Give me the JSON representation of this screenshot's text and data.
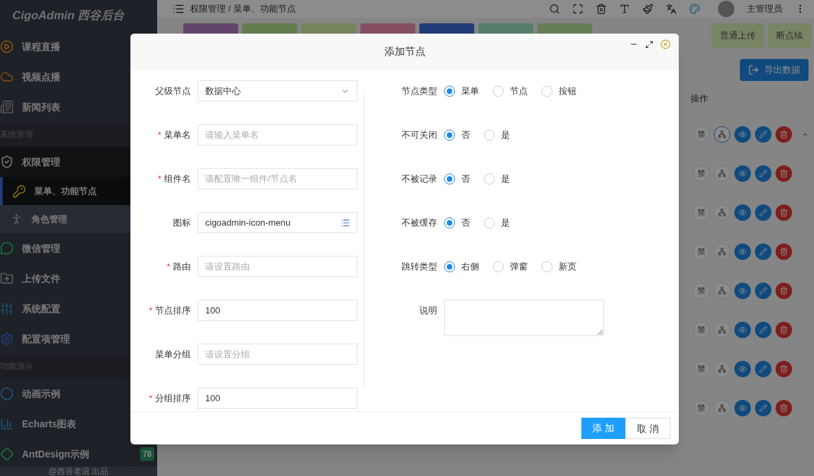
{
  "sidebar": {
    "logo": "CigoAdmin 西谷后台",
    "items": [
      {
        "kind": "item",
        "label": "课程直播",
        "selected": false
      },
      {
        "kind": "item",
        "label": "视频点播",
        "selected": false
      },
      {
        "kind": "item",
        "label": "新闻列表",
        "selected": false
      },
      {
        "kind": "group",
        "label": "系统管理"
      },
      {
        "kind": "item",
        "label": "权限管理",
        "selected": false,
        "expanded": true,
        "children": [
          {
            "label": "菜单、功能节点",
            "selected": true
          },
          {
            "label": "角色管理",
            "selected": false
          }
        ]
      },
      {
        "kind": "item",
        "label": "微信管理",
        "selected": false
      },
      {
        "kind": "item",
        "label": "上传文件",
        "selected": false
      },
      {
        "kind": "item",
        "label": "系统配置",
        "selected": false
      },
      {
        "kind": "item",
        "label": "配置项管理",
        "selected": false
      },
      {
        "kind": "group",
        "label": "功能演示"
      },
      {
        "kind": "item",
        "label": "动画示例",
        "selected": false
      },
      {
        "kind": "item",
        "label": "Echarts图表",
        "selected": false
      },
      {
        "kind": "item",
        "label": "AntDesign示例",
        "badge": "78",
        "selected": false
      }
    ],
    "footer": "@西谷老温 出品"
  },
  "topbar": {
    "breadcrumb": "权限管理 / 菜单、功能节点",
    "user": "主管理员"
  },
  "upload_tabs": [
    "普通上传",
    "断点续"
  ],
  "export_button": "导出数据",
  "table": {
    "action_header": "操作",
    "rows": [
      {
        "ban": "禁",
        "focused": true
      },
      {
        "ban": "禁",
        "focused": false
      },
      {
        "ban": "禁",
        "focused": false
      },
      {
        "ban": "禁",
        "focused": false
      },
      {
        "ban": "禁",
        "focused": false
      },
      {
        "ban": "禁",
        "focused": false
      },
      {
        "ban": "禁",
        "focused": false
      },
      {
        "ban": "禁",
        "focused": false
      }
    ]
  },
  "dialog": {
    "title": "添加节点",
    "left_fields": [
      {
        "kind": "select",
        "label": "父级节点",
        "value": "数据中心"
      },
      {
        "kind": "input",
        "label": "菜单名",
        "mark": "*",
        "placeholder": "请输入菜单名"
      },
      {
        "kind": "input",
        "label": "组件名",
        "mark": "*",
        "placeholder": "请配置唯一组件/节点名"
      },
      {
        "kind": "icon",
        "label": "图标",
        "value": "cigoadmin-icon-menu"
      },
      {
        "kind": "input",
        "label": "路由",
        "mark": "*",
        "placeholder": "请设置路由"
      },
      {
        "kind": "input",
        "label": "节点排序",
        "mark": "*",
        "value": "100"
      },
      {
        "kind": "input",
        "label": "菜单分组",
        "placeholder": "请设置分组"
      },
      {
        "kind": "input",
        "label": "分组排序",
        "mark": "*",
        "value": "100"
      }
    ],
    "right_fields": [
      {
        "kind": "radio",
        "label": "节点类型",
        "options": [
          {
            "label": "菜单",
            "selected": true
          },
          {
            "label": "节点",
            "selected": false
          },
          {
            "label": "按钮",
            "selected": false
          }
        ]
      },
      {
        "kind": "radio",
        "label": "不可关闭",
        "options": [
          {
            "label": "否",
            "selected": true
          },
          {
            "label": "是",
            "selected": false
          }
        ]
      },
      {
        "kind": "radio",
        "label": "不被记录",
        "options": [
          {
            "label": "否",
            "selected": true
          },
          {
            "label": "是",
            "selected": false
          }
        ]
      },
      {
        "kind": "radio",
        "label": "不被缓存",
        "options": [
          {
            "label": "否",
            "selected": true
          },
          {
            "label": "是",
            "selected": false
          }
        ]
      },
      {
        "kind": "radio",
        "label": "跳转类型",
        "options": [
          {
            "label": "右侧",
            "selected": true
          },
          {
            "label": "弹窗",
            "selected": false
          },
          {
            "label": "新页",
            "selected": false
          }
        ]
      },
      {
        "kind": "textarea",
        "label": "说明"
      }
    ],
    "buttons": [
      {
        "label": "添 加",
        "primary": true
      },
      {
        "label": "取 消",
        "primary": false
      }
    ]
  }
}
